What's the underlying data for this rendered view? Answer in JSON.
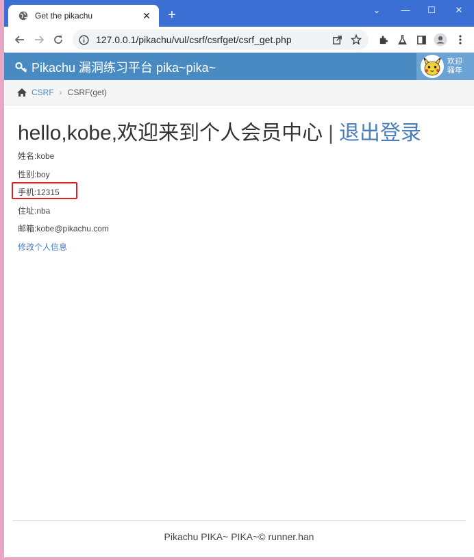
{
  "browser": {
    "tab": {
      "title": "Get the pikachu",
      "favicon": "globe-icon",
      "close_glyph": "✕"
    },
    "new_tab_glyph": "+",
    "window_controls": {
      "chevron": "⌄",
      "minimize": "—",
      "maximize": "☐",
      "close": "✕"
    },
    "url": "127.0.0.1/pikachu/vul/csrf/csrfget/csrf_get.php",
    "toolbar_icons": [
      "share-icon",
      "star-icon",
      "extensions-icon",
      "labs-icon",
      "sidepanel-icon",
      "profile-icon",
      "menu-icon"
    ]
  },
  "site": {
    "brand": "Pikachu 漏洞练习平台 pika~pika~",
    "welcome_line1": "欢迎",
    "welcome_line2": "骚年"
  },
  "breadcrumb": {
    "section": "CSRF",
    "current": "CSRF(get)"
  },
  "profile": {
    "greeting": "hello,kobe,欢迎来到个人会员中心",
    "separator": "|",
    "logout": "退出登录",
    "name": "姓名:kobe",
    "sex": "性别:boy",
    "phone": "手机:12315",
    "address": "住址:nba",
    "email": "邮箱:kobe@pikachu.com",
    "edit_link": "修改个人信息"
  },
  "footer": "Pikachu PIKA~ PIKA~© runner.han",
  "colors": {
    "tabstrip": "#3b6fd4",
    "header": "#4a8ac3",
    "link": "#4a7dbd",
    "highlight": "#e02020"
  }
}
